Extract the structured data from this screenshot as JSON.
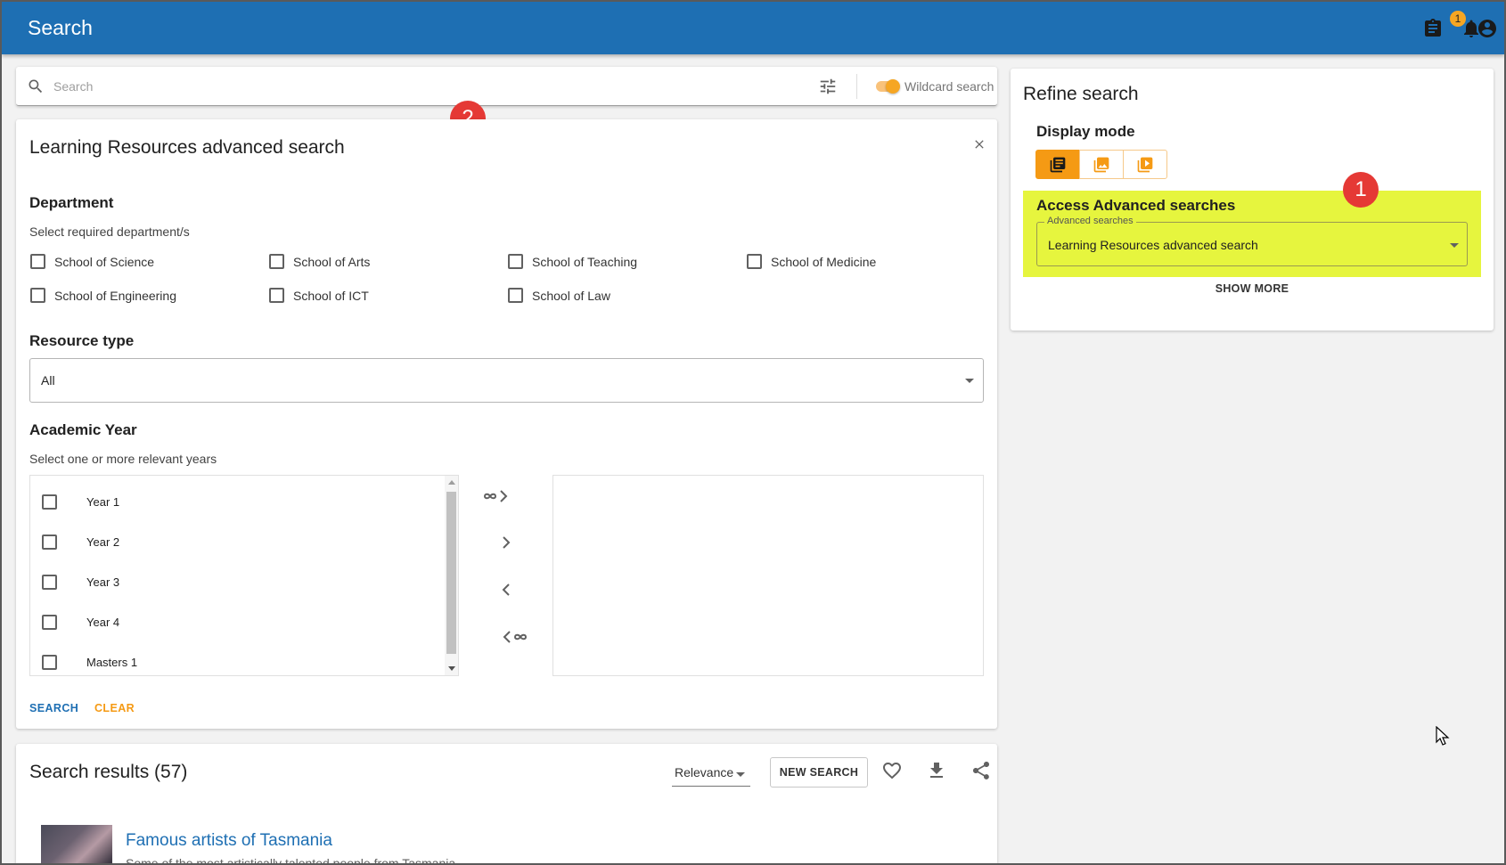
{
  "app": {
    "title": "Search",
    "notification_count": "1"
  },
  "search": {
    "placeholder": "Search",
    "value": "",
    "wildcard_label": "Wildcard search",
    "wildcard_enabled": true
  },
  "advanced": {
    "title": "Learning Resources advanced search",
    "department": {
      "label": "Department",
      "hint": "Select required department/s",
      "options": [
        "School of Science",
        "School of Arts",
        "School of Teaching",
        "School of Medicine",
        "School of Engineering",
        "School of ICT",
        "School of Law"
      ]
    },
    "resource_type": {
      "label": "Resource type",
      "value": "All"
    },
    "academic_year": {
      "label": "Academic Year",
      "hint": "Select one or more relevant years",
      "options": [
        "Year 1",
        "Year 2",
        "Year 3",
        "Year 4",
        "Masters 1"
      ]
    },
    "search_label": "SEARCH",
    "clear_label": "CLEAR"
  },
  "results": {
    "title": "Search results (57)",
    "sort_value": "Relevance",
    "new_search_label": "NEW SEARCH",
    "items": [
      {
        "title": "Famous artists of Tasmania",
        "description": "Some of the most artistically talented people from Tasmania"
      }
    ]
  },
  "refine": {
    "title": "Refine search",
    "display_mode_label": "Display mode",
    "display_modes": [
      "list-icon",
      "gallery-image-icon",
      "video-icon"
    ],
    "active_mode": 0,
    "access_title": "Access Advanced searches",
    "advanced_searches_label": "Advanced searches",
    "advanced_searches_value": "Learning Resources advanced search",
    "show_more_label": "SHOW MORE"
  },
  "markers": [
    "1",
    "2"
  ],
  "colors": {
    "primary": "#1e6fb3",
    "accent": "#f59a14",
    "highlight": "#e6f53e",
    "marker": "#e53935"
  }
}
